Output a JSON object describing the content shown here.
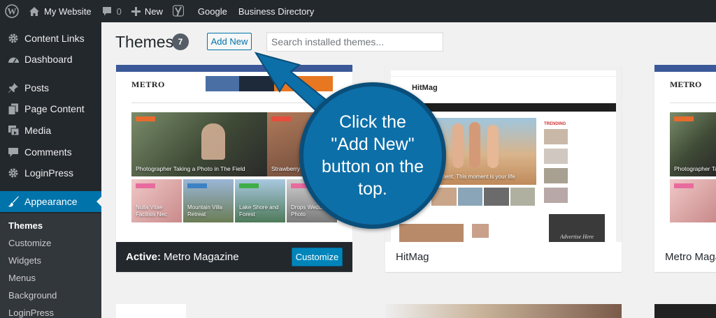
{
  "adminbar": {
    "site_name": "My Website",
    "comments_count": "0",
    "new_label": "New",
    "google_label": "Google",
    "directory_label": "Business Directory"
  },
  "sidebar": {
    "items": [
      {
        "label": "Content Links",
        "icon": "gear-icon"
      },
      {
        "label": "Dashboard",
        "icon": "dashboard-icon"
      },
      {
        "label": "Posts",
        "icon": "pin-icon"
      },
      {
        "label": "Page Content",
        "icon": "pages-icon"
      },
      {
        "label": "Media",
        "icon": "media-icon"
      },
      {
        "label": "Comments",
        "icon": "comment-icon"
      },
      {
        "label": "LoginPress",
        "icon": "gear-icon"
      },
      {
        "label": "Appearance",
        "icon": "brush-icon"
      }
    ],
    "submenu": [
      "Themes",
      "Customize",
      "Widgets",
      "Menus",
      "Background",
      "LoginPress"
    ]
  },
  "header": {
    "title": "Themes",
    "count": "7",
    "add_new_label": "Add New",
    "search_placeholder": "Search installed themes..."
  },
  "themes": {
    "active": {
      "active_label": "Active:",
      "name": "Metro Magazine",
      "customize_label": "Customize",
      "logo": "METRO",
      "captions": [
        "Photographer Taking a Photo in The Field",
        "Strawberry"
      ],
      "small_captions": [
        "Nulla Vitae Facilisis Nec",
        "Mountain Villa Retreat",
        "Lake Shore and Forest",
        "Drops Wedding Photo"
      ]
    },
    "second": {
      "name": "HitMag",
      "logo": "HitMag",
      "hero_caption": "moment, This moment is your life",
      "trending_label": "TRENDING",
      "ad_label": "Advertise Here"
    },
    "third": {
      "name": "Metro Magazine",
      "logo": "METRO",
      "caption": "Photographer Taking"
    }
  },
  "callout": {
    "text": "Click the \"Add New\" button on the top."
  },
  "colors": {
    "admin_dark": "#23282d",
    "wp_blue": "#0073aa",
    "button_blue": "#0085ba",
    "callout_blue": "#0d6fa8"
  }
}
